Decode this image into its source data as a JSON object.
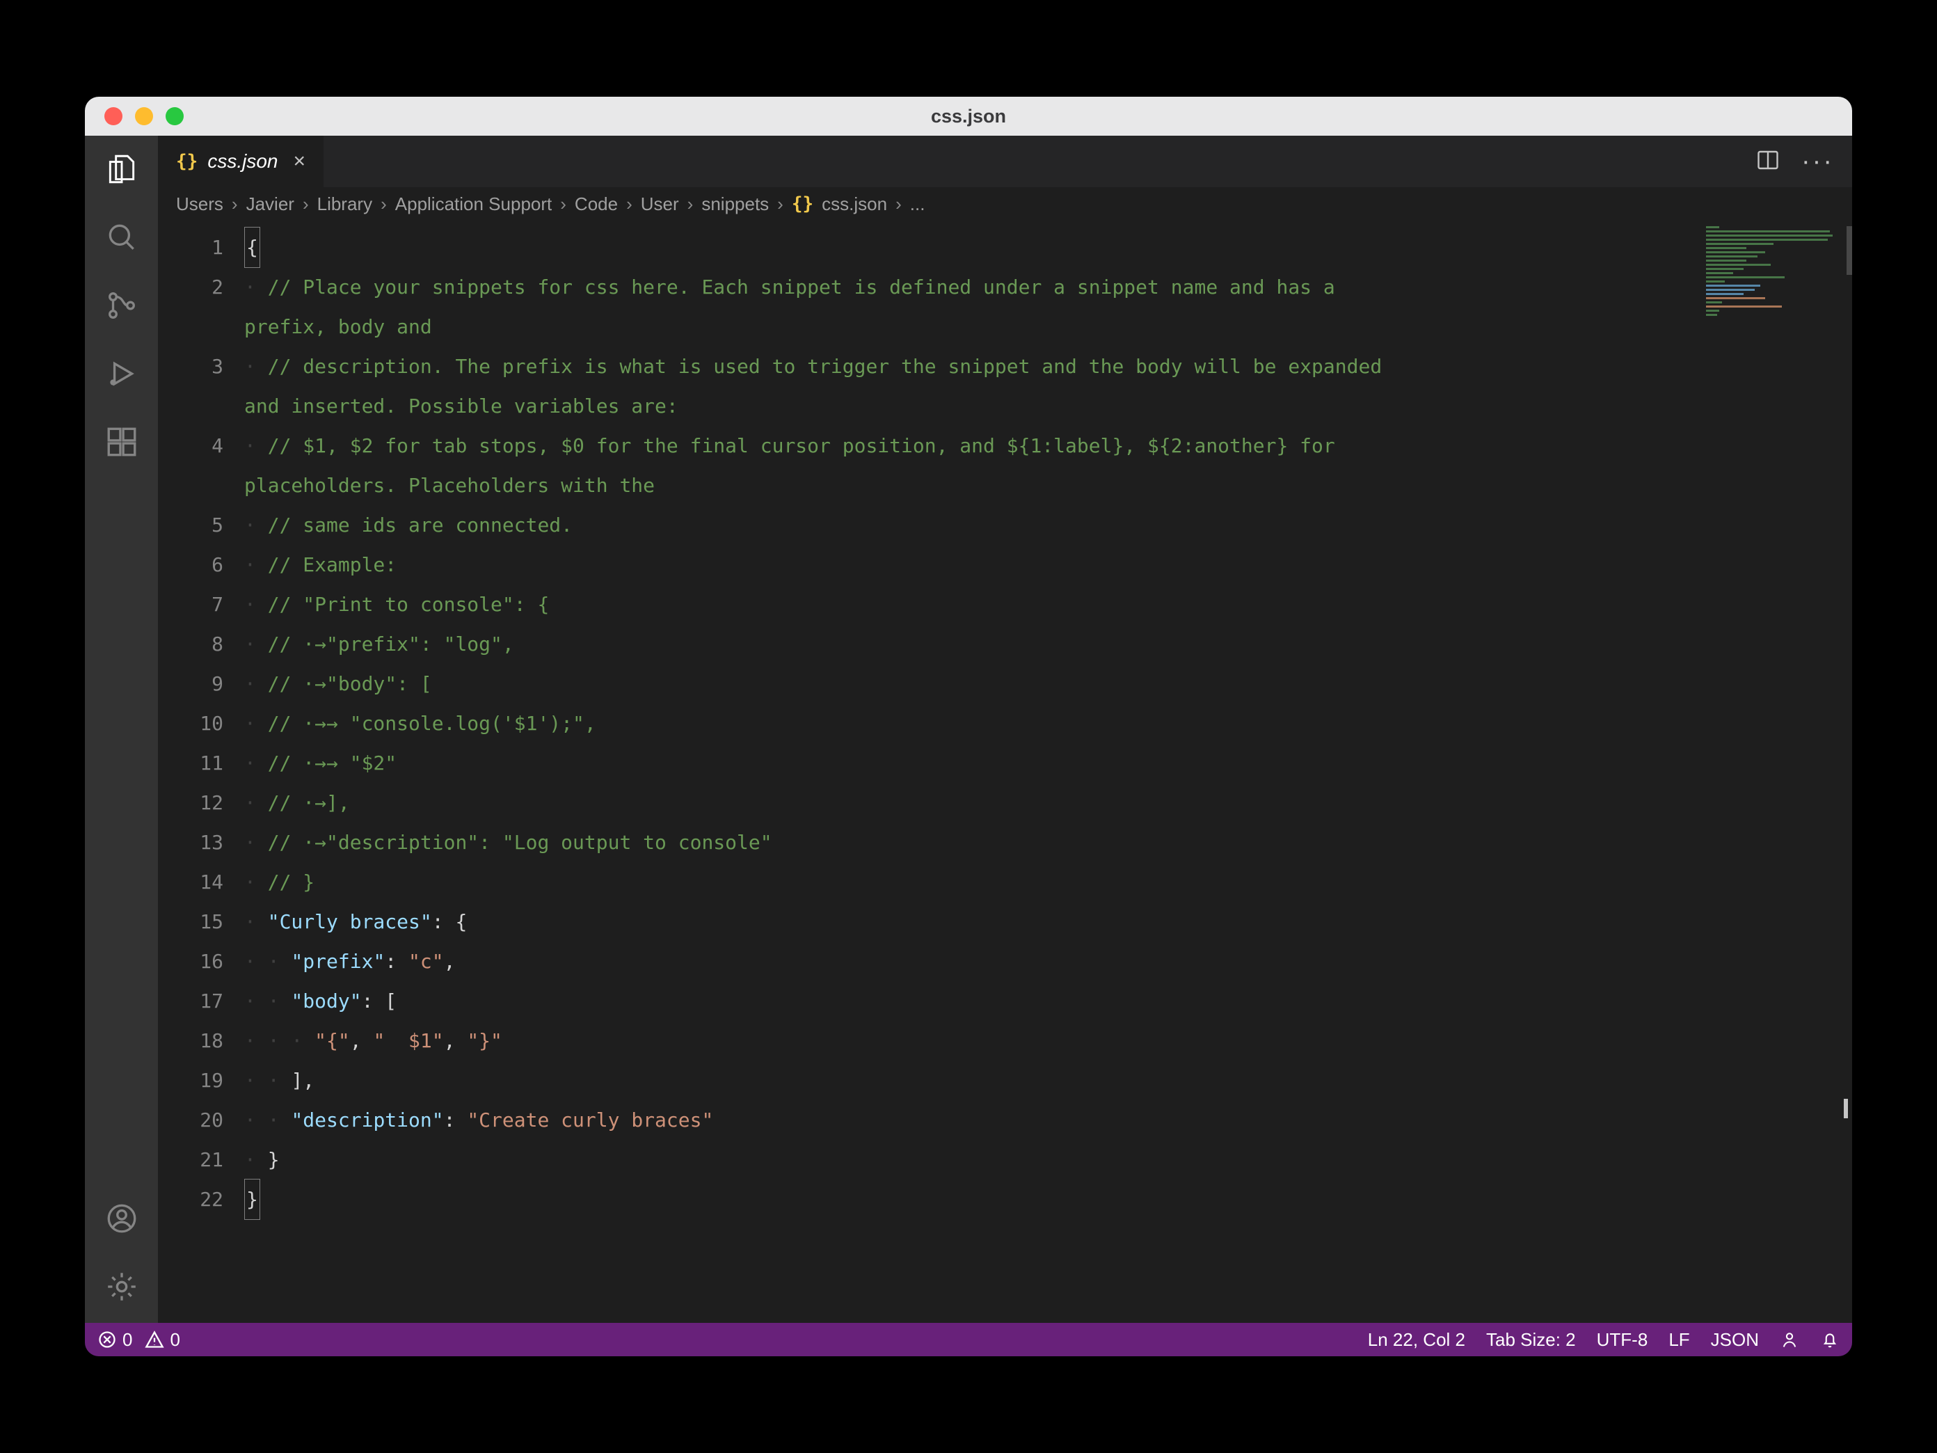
{
  "window": {
    "title": "css.json"
  },
  "traffic": {
    "close": "close",
    "minimize": "minimize",
    "zoom": "zoom"
  },
  "activitybar": {
    "explorer": "Explorer",
    "search": "Search",
    "scm": "Source Control",
    "debug": "Run and Debug",
    "extensions": "Extensions",
    "account": "Accounts",
    "settings": "Manage"
  },
  "tab": {
    "icon": "{}",
    "label": "css.json",
    "close": "×"
  },
  "tab_actions": {
    "split": "Split Editor",
    "more": "···"
  },
  "breadcrumbs": {
    "items": [
      "Users",
      "Javier",
      "Library",
      "Application Support",
      "Code",
      "User",
      "snippets"
    ],
    "file_icon": "{}",
    "file": "css.json",
    "tail": "..."
  },
  "editor": {
    "line_numbers": [
      "1",
      "2",
      "",
      "3",
      "",
      "4",
      "",
      "5",
      "6",
      "7",
      "8",
      "9",
      "10",
      "11",
      "12",
      "13",
      "14",
      "15",
      "16",
      "17",
      "18",
      "19",
      "20",
      "21",
      "22"
    ],
    "code_rows": [
      {
        "type": "punct",
        "text": "{",
        "boxed": true
      },
      {
        "type": "comment",
        "indent": 1,
        "text": "// Place your snippets for css here. Each snippet is defined under a snippet name and has a "
      },
      {
        "type": "comment",
        "indent": 1,
        "text": "prefix, body and ",
        "continuation": true
      },
      {
        "type": "comment",
        "indent": 1,
        "text": "// description. The prefix is what is used to trigger the snippet and the body will be expanded "
      },
      {
        "type": "comment",
        "indent": 1,
        "text": "and inserted. Possible variables are:",
        "continuation": true
      },
      {
        "type": "comment",
        "indent": 1,
        "text": "// $1, $2 for tab stops, $0 for the final cursor position, and ${1:label}, ${2:another} for "
      },
      {
        "type": "comment",
        "indent": 1,
        "text": "placeholders. Placeholders with the ",
        "continuation": true
      },
      {
        "type": "comment",
        "indent": 1,
        "text": "// same ids are connected."
      },
      {
        "type": "comment",
        "indent": 1,
        "text": "// Example:"
      },
      {
        "type": "comment",
        "indent": 1,
        "text": "// \"Print to console\": {"
      },
      {
        "type": "comment",
        "indent": 1,
        "text": "// ·→\"prefix\": \"log\","
      },
      {
        "type": "comment",
        "indent": 1,
        "text": "// ·→\"body\": ["
      },
      {
        "type": "comment",
        "indent": 1,
        "text": "// ·→→ \"console.log('$1');\","
      },
      {
        "type": "comment",
        "indent": 1,
        "text": "// ·→→ \"$2\""
      },
      {
        "type": "comment",
        "indent": 1,
        "text": "// ·→],"
      },
      {
        "type": "comment",
        "indent": 1,
        "text": "// ·→\"description\": \"Log output to console\""
      },
      {
        "type": "comment",
        "indent": 1,
        "text": "// }"
      },
      {
        "type": "kv_open",
        "indent": 1,
        "key": "\"Curly braces\"",
        "after": ": {"
      },
      {
        "type": "kv_str",
        "indent": 2,
        "key": "\"prefix\"",
        "val": "\"c\"",
        "comma": ","
      },
      {
        "type": "kv_open",
        "indent": 2,
        "key": "\"body\"",
        "after": ": ["
      },
      {
        "type": "arr3",
        "indent": 3,
        "a": "\"{\"",
        "b": "\"  $1\"",
        "c": "\"}\""
      },
      {
        "type": "punct_indent",
        "indent": 2,
        "text": "],"
      },
      {
        "type": "kv_str",
        "indent": 2,
        "key": "\"description\"",
        "val": "\"Create curly braces\"",
        "comma": ""
      },
      {
        "type": "punct_indent",
        "indent": 1,
        "text": "}"
      },
      {
        "type": "punct",
        "text": "}",
        "boxed": true
      }
    ]
  },
  "status": {
    "errors": "0",
    "warnings": "0",
    "cursor": "Ln 22, Col 2",
    "tabsize": "Tab Size: 2",
    "encoding": "UTF-8",
    "eol": "LF",
    "lang": "JSON"
  }
}
